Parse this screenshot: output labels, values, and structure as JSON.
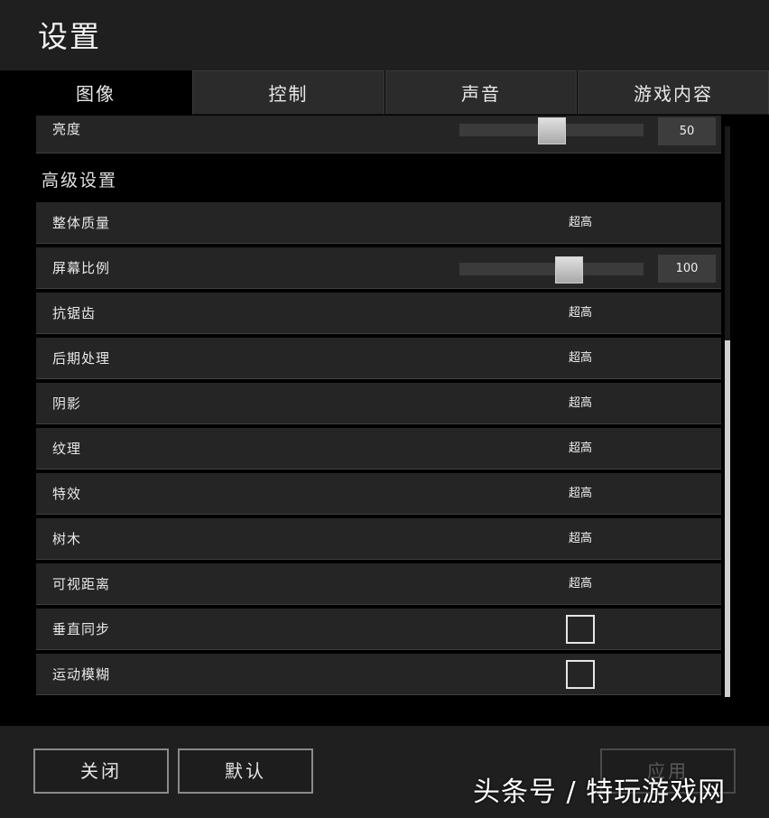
{
  "window": {
    "title": "设置"
  },
  "tabs": [
    {
      "label": "图像",
      "active": true
    },
    {
      "label": "控制",
      "active": false
    },
    {
      "label": "声音",
      "active": false
    },
    {
      "label": "游戏内容",
      "active": false
    }
  ],
  "settings": {
    "brightness": {
      "label": "亮度",
      "value": "50",
      "level_percent": 50
    },
    "advanced_title": "高级设置",
    "rows": [
      {
        "label": "整体质量",
        "value": "超高"
      },
      {
        "label": "屏幕比例",
        "value": "100",
        "level_percent": 61
      },
      {
        "label": "抗锯齿",
        "value": "超高"
      },
      {
        "label": "后期处理",
        "value": "超高"
      },
      {
        "label": "阴影",
        "value": "超高"
      },
      {
        "label": "纹理",
        "value": "超高"
      },
      {
        "label": "特效",
        "value": "超高"
      },
      {
        "label": "树木",
        "value": "超高"
      },
      {
        "label": "可视距离",
        "value": "超高"
      },
      {
        "label": "垂直同步",
        "checked": false
      },
      {
        "label": "运动模糊",
        "checked": false
      }
    ]
  },
  "footer": {
    "close_label": "关闭",
    "default_label": "默认",
    "apply_label": "应用"
  },
  "watermark": "头条号 / 特玩游戏网",
  "colors": {
    "background": "#000000",
    "row": "#252525",
    "titlebar": "#1f1f1f",
    "text": "#e6e6e6"
  }
}
